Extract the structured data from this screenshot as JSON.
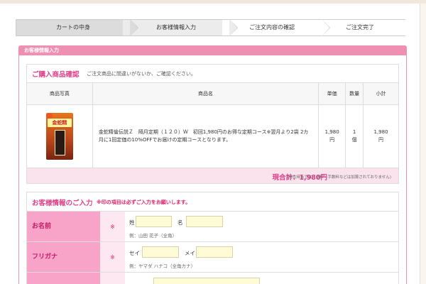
{
  "steps": [
    {
      "label": "カートの中身"
    },
    {
      "label": "お客様情報入力"
    },
    {
      "label": "ご注文内容の確認"
    },
    {
      "label": "ご注文完了"
    }
  ],
  "section_header": "お客様情報入力",
  "confirm": {
    "title": "ご購入商品確認",
    "subtitle": "ご注文商品に間違いがないか、ご確認ください。",
    "columns": [
      "商品写真",
      "商品名",
      "単価",
      "数量",
      "小計"
    ],
    "item": {
      "image_label": "金蛇精",
      "name": "金蛇精倫伝説Ｚ　隔月定期（１２０）Ｗ　初回1,980円のお得な定期コース※翌月より2袋 2カ月に1回定価の10%OFFでお届けの定期コースとなります。",
      "price_line1": "1,980",
      "price_line2": "円",
      "qty_line1": "1",
      "qty_line2": "個",
      "subtotal_line1": "1,980",
      "subtotal_line2": "円"
    },
    "total": "現合計：1,980円",
    "total_note": "(現在時点では、送料・手数料などは加算されておりません)"
  },
  "customer": {
    "title": "お客様情報のご入力",
    "subtitle": "※印の項目は必ずご入力をお願いします。",
    "required_mark": "※",
    "rows": [
      {
        "label": "お名前",
        "field1_label": "姓",
        "field2_label": "名",
        "example": "例：山田 花子（全角）"
      },
      {
        "label": "フリガナ",
        "field1_label": "セイ",
        "field2_label": "メイ",
        "example": "例：ヤマダ ハナコ（全角カナ）"
      }
    ]
  },
  "colors": {
    "accent_pink": "#e0408a",
    "header_bar": "#ef8fb2",
    "label_bg": "#f7a4c8",
    "input_bg": "#fffbd6"
  }
}
